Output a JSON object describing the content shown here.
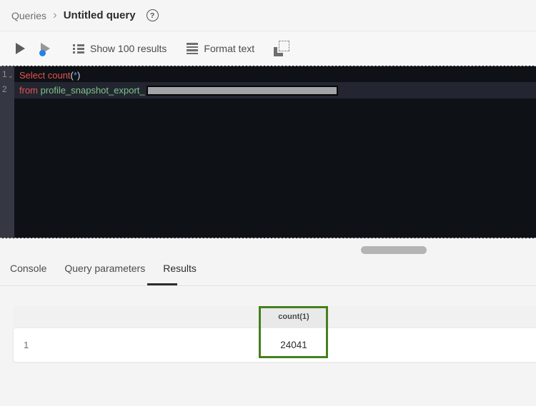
{
  "breadcrumb": {
    "parent": "Queries",
    "separator": "›",
    "current": "Untitled query"
  },
  "icons": {
    "help_glyph": "?",
    "fold_glyph": "⌄"
  },
  "toolbar": {
    "show_results_label": "Show 100 results",
    "format_text_label": "Format text"
  },
  "editor": {
    "line_numbers": [
      "1",
      "2"
    ],
    "lines": [
      {
        "tokens": [
          {
            "text": "Select count",
            "type": "keyword"
          },
          {
            "text": "(",
            "type": "plain"
          },
          {
            "text": "*",
            "type": "operator"
          },
          {
            "text": ")",
            "type": "plain"
          }
        ]
      },
      {
        "tokens": [
          {
            "text": "from ",
            "type": "keyword"
          },
          {
            "text": "profile_snapshot_export_",
            "type": "identifier"
          }
        ]
      }
    ]
  },
  "tabs": [
    {
      "label": "Console"
    },
    {
      "label": "Query parameters"
    },
    {
      "label": "Results"
    }
  ],
  "results_table": {
    "column_header": "count(1)",
    "row_index": "1",
    "value": "24041"
  },
  "colors": {
    "keyword": "#e5534e",
    "identifier": "#7dc588",
    "operator": "#4f9cf0",
    "annotation_green": "#45801d",
    "accent_blue": "#2680eb"
  }
}
